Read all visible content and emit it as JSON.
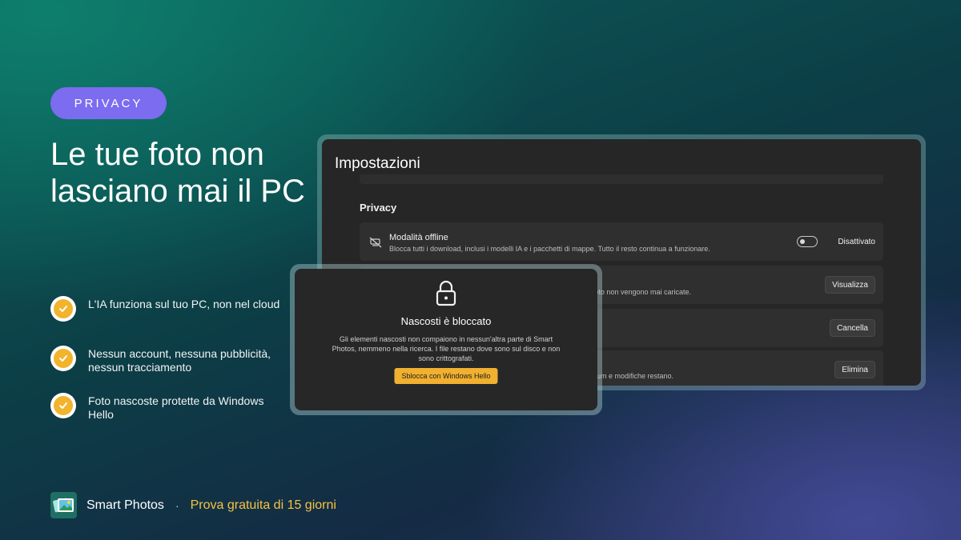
{
  "badge": "PRIVACY",
  "headline": "Le tue foto non lasciano mai il PC",
  "features": [
    {
      "text": "L'IA funziona sul tuo PC, non nel cloud"
    },
    {
      "text": "Nessun account, nessuna pubblicità, nessun tracciamento"
    },
    {
      "text": "Foto nascoste protette da Windows Hello"
    }
  ],
  "footer": {
    "app_name": "Smart Photos",
    "separator": "·",
    "trial": "Prova gratuita di 15 giorni"
  },
  "settings": {
    "title": "Impostazioni",
    "section": "Privacy",
    "rows": [
      {
        "icon": "offline-icon",
        "title": "Modalità offline",
        "description": "Blocca tutti i download, inclusi i modelli IA e i pacchetti di mappe. Tutto il resto continua a funzionare.",
        "toggle_state": "off",
        "toggle_label": "Disattivato"
      },
      {
        "description": "foto non vengono mai caricate.",
        "button": "Visualizza"
      },
      {
        "button": "Cancella"
      },
      {
        "description": "bum e modifiche restano.",
        "button": "Elimina"
      }
    ]
  },
  "dialog": {
    "icon": "lock-icon",
    "title": "Nascosti è bloccato",
    "body": "Gli elementi nascosti non compaiono in nessun'altra parte di Smart Photos, nemmeno nella ricerca. I file restano dove sono sul disco e non sono crittografati.",
    "button": "Sblocca con Windows Hello"
  },
  "colors": {
    "badge": "#7c6cf0",
    "accent": "#f2b42c",
    "trial_text": "#f4c343"
  }
}
